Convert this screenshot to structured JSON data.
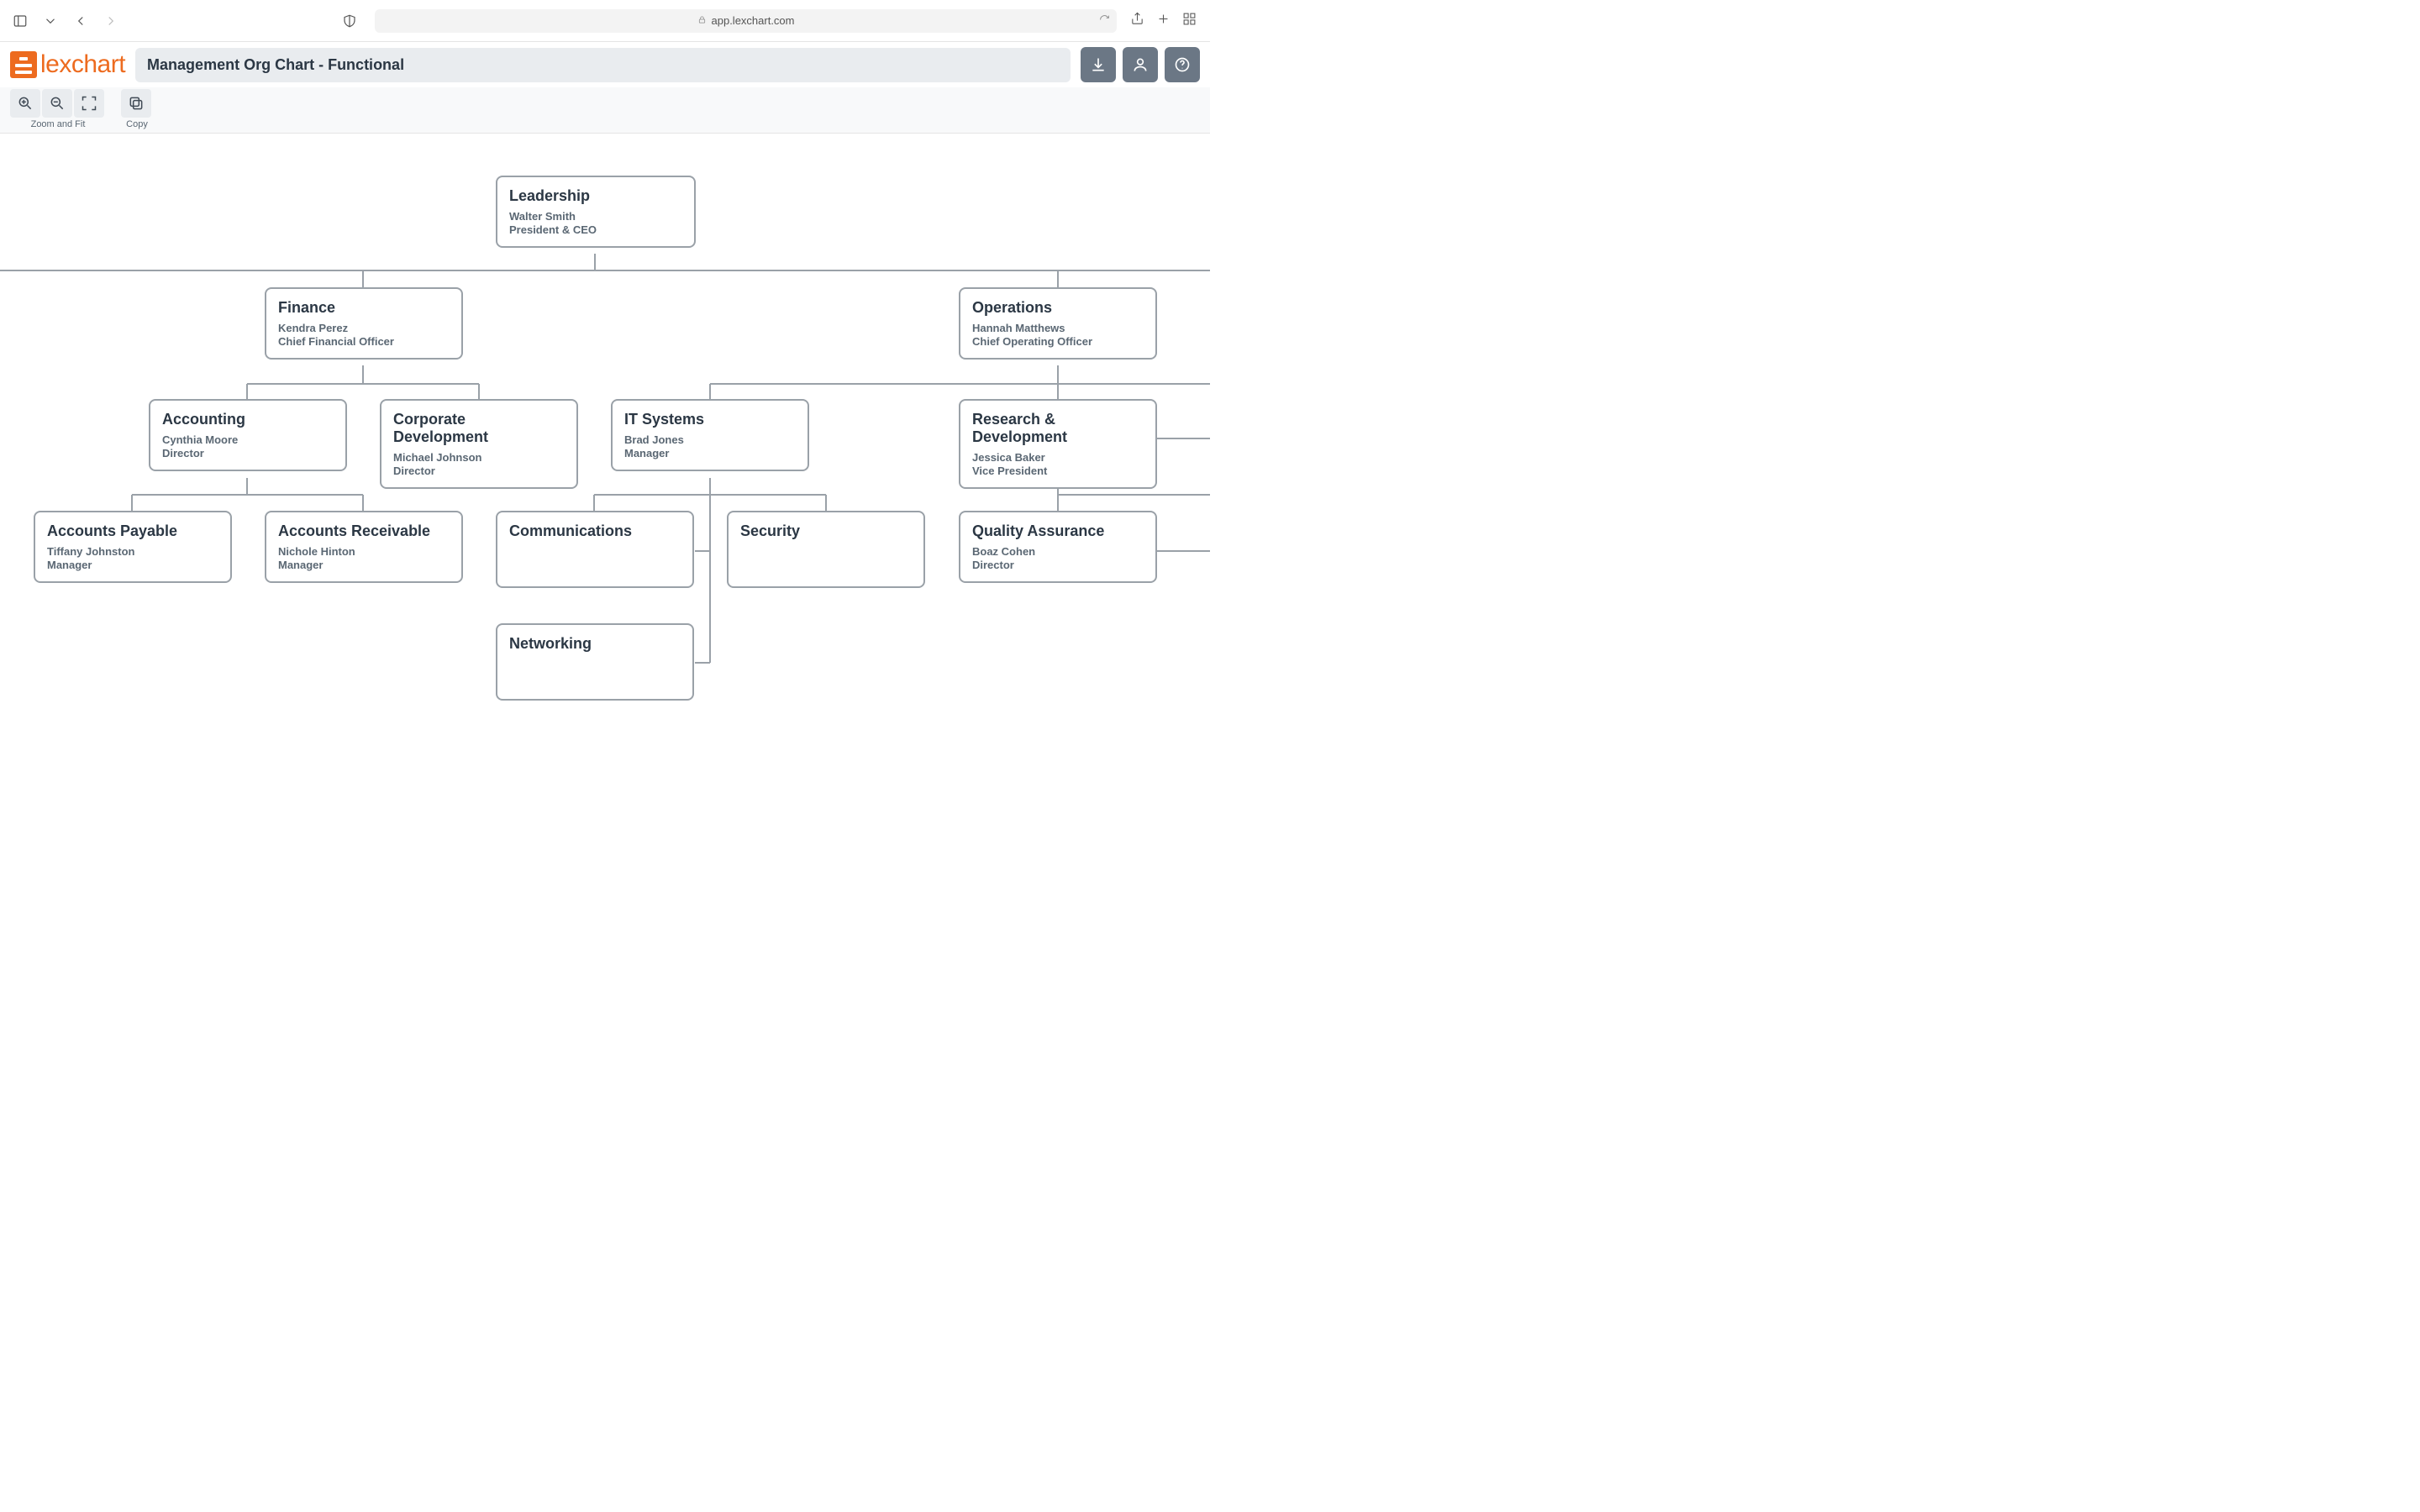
{
  "browser": {
    "url": "app.lexchart.com"
  },
  "app": {
    "brand": "lexchart",
    "doc_title": "Management Org Chart - Functional"
  },
  "toolbar": {
    "zoom_fit_label": "Zoom and Fit",
    "copy_label": "Copy"
  },
  "org": {
    "nodes": {
      "leadership": {
        "dept": "Leadership",
        "person": "Walter Smith",
        "role": "President & CEO"
      },
      "finance": {
        "dept": "Finance",
        "person": "Kendra Perez",
        "role": "Chief Financial Officer"
      },
      "operations": {
        "dept": "Operations",
        "person": "Hannah Matthews",
        "role": "Chief Operating Officer"
      },
      "accounting": {
        "dept": "Accounting",
        "person": "Cynthia Moore",
        "role": "Director"
      },
      "corpdev": {
        "dept": "Corporate Development",
        "person": "Michael Johnson",
        "role": "Director"
      },
      "it": {
        "dept": "IT Systems",
        "person": "Brad Jones",
        "role": "Manager"
      },
      "rnd": {
        "dept": "Research & Development",
        "person": "Jessica Baker",
        "role": "Vice President"
      },
      "ap": {
        "dept": "Accounts Payable",
        "person": "Tiffany Johnston",
        "role": "Manager"
      },
      "ar": {
        "dept": "Accounts Receivable",
        "person": "Nichole Hinton",
        "role": "Manager"
      },
      "comms": {
        "dept": "Communications",
        "person": "",
        "role": ""
      },
      "security": {
        "dept": "Security",
        "person": "",
        "role": ""
      },
      "networking": {
        "dept": "Networking",
        "person": "",
        "role": ""
      },
      "qa": {
        "dept": "Quality Assurance",
        "person": "Boaz Cohen",
        "role": "Director"
      }
    }
  }
}
